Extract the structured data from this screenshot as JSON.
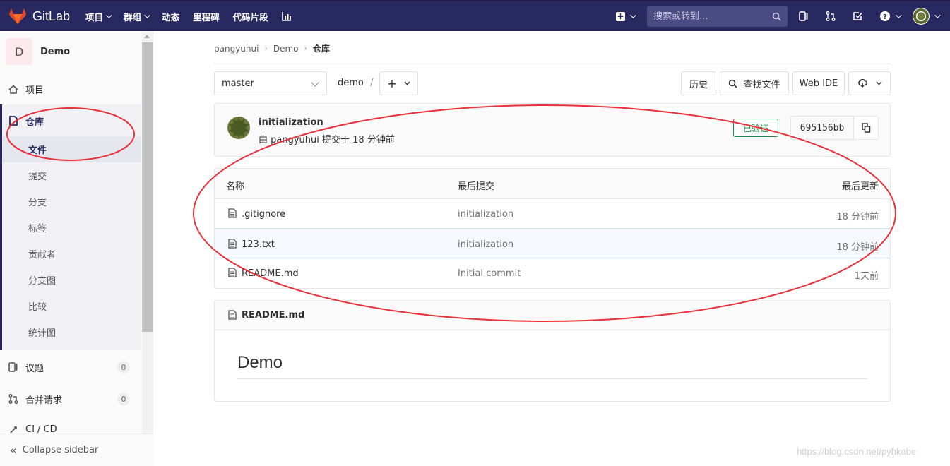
{
  "topbar": {
    "brand": "GitLab",
    "nav": [
      "项目",
      "群组",
      "动态",
      "里程碑",
      "代码片段"
    ],
    "search_placeholder": "搜索或转到...",
    "bg_color": "#292961"
  },
  "sidebar": {
    "project_initial": "D",
    "project_name": "Demo",
    "project_item": "项目",
    "repo": "仓库",
    "repo_sub": [
      "文件",
      "提交",
      "分支",
      "标签",
      "贡献者",
      "分支图",
      "比较",
      "统计图"
    ],
    "issues": "议题",
    "issues_count": "0",
    "mr": "合并请求",
    "mr_count": "0",
    "cicd": "CI / CD",
    "collapse": "Collapse sidebar"
  },
  "breadcrumb": [
    "pangyuhui",
    "Demo",
    "仓库"
  ],
  "toolbar": {
    "branch": "master",
    "path": "demo",
    "path_sep": "/",
    "history": "历史",
    "find_file": "查找文件",
    "web_ide": "Web IDE"
  },
  "commit": {
    "title": "initialization",
    "meta": "由 pangyuhui 提交于 18 分钟前",
    "verified": "已验证",
    "sha": "695156bb"
  },
  "tree": {
    "headers": [
      "名称",
      "最后提交",
      "最后更新"
    ],
    "rows": [
      {
        "name": ".gitignore",
        "commit": "initialization",
        "time": "18 分钟前"
      },
      {
        "name": "123.txt",
        "commit": "initialization",
        "time": "18 分钟前"
      },
      {
        "name": "README.md",
        "commit": "Initial commit",
        "time": "1天前"
      }
    ]
  },
  "readme": {
    "file": "README.md",
    "heading": "Demo"
  },
  "watermark": "https://blog.csdn.net/pyhkobe",
  "annotation_color": "#e8313a"
}
